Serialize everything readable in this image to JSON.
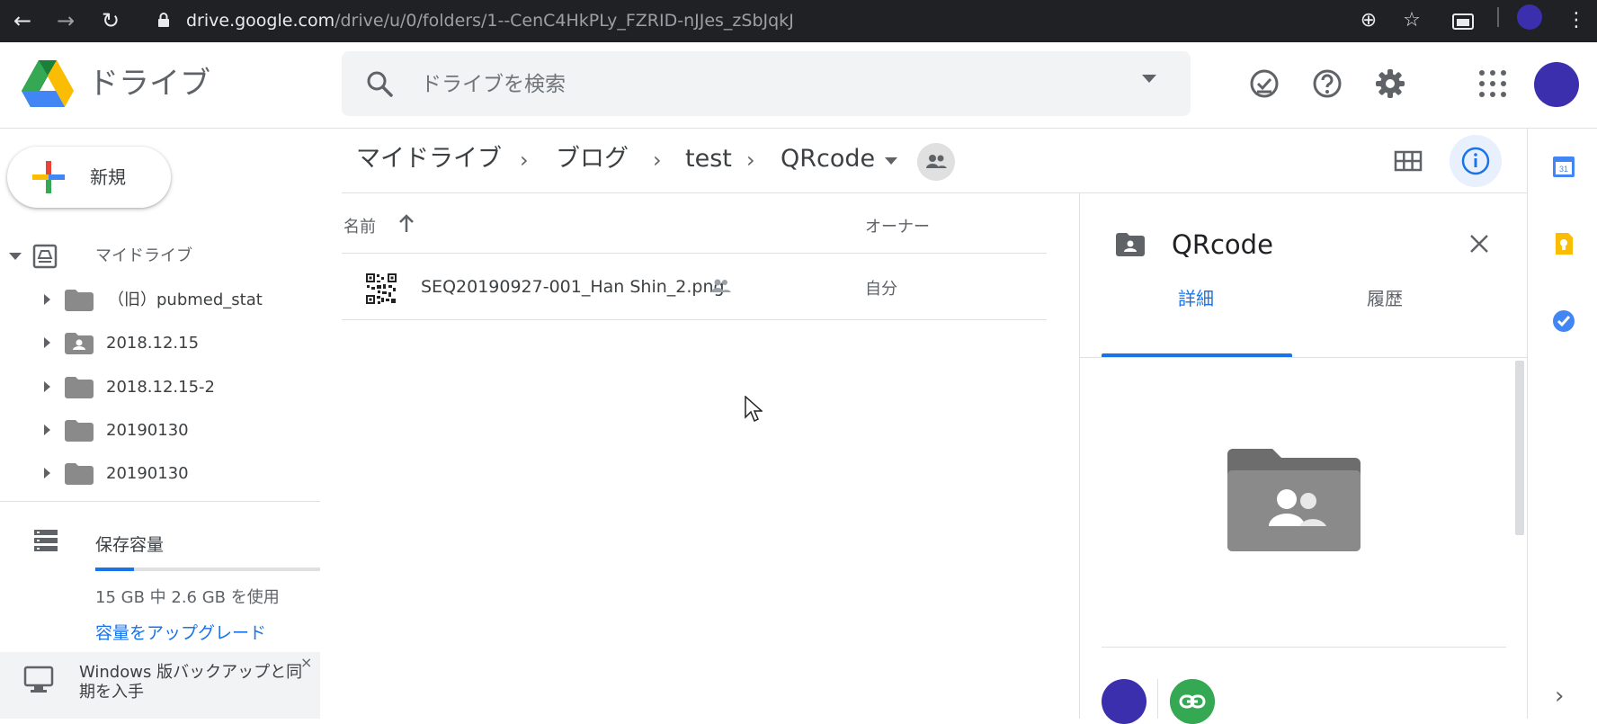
{
  "browser": {
    "url_host": "drive.google.com",
    "url_path": "/drive/u/0/folders/1--CenC4HkPLy_FZRID-nJJes_zSbJqkJ"
  },
  "header": {
    "product_name": "ドライブ",
    "search_placeholder": "ドライブを検索"
  },
  "sidebar": {
    "new_label": "新規",
    "my_drive_label": "マイドライブ",
    "tree": [
      {
        "label": "（旧）pubmed_stat",
        "icon": "folder-icon"
      },
      {
        "label": "2018.12.15",
        "icon": "shared-folder-icon"
      },
      {
        "label": "2018.12.15-2",
        "icon": "folder-icon"
      },
      {
        "label": "20190130",
        "icon": "folder-icon"
      },
      {
        "label": "20190130",
        "icon": "folder-icon"
      }
    ],
    "storage": {
      "label": "保存容量",
      "used_fraction": 0.17,
      "usage_text": "15 GB 中 2.6 GB を使用",
      "upgrade_label": "容量をアップグレード"
    },
    "backup_banner": {
      "text": "Windows 版バックアップと同期を入手",
      "close_glyph": "×"
    }
  },
  "breadcrumb": {
    "items": [
      "マイドライブ",
      "ブログ",
      "test",
      "QRcode"
    ],
    "separator": "›"
  },
  "file_list": {
    "columns": {
      "name": "名前",
      "owner": "オーナー"
    },
    "rows": [
      {
        "name": "SEQ20190927-001_Han Shin_2.png",
        "owner": "自分",
        "shared": true
      }
    ]
  },
  "details_panel": {
    "title": "QRcode",
    "tabs": [
      "詳細",
      "履歴"
    ],
    "active_tab": "詳細"
  },
  "colors": {
    "accent": "#1a73e8",
    "avatar": "#3b2fae",
    "link_green": "#34a853",
    "chrome_bg": "#202124"
  }
}
